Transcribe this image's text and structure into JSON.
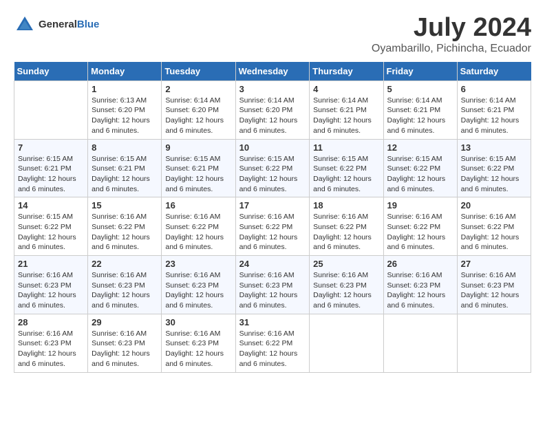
{
  "header": {
    "logo_general": "General",
    "logo_blue": "Blue",
    "month_title": "July 2024",
    "location": "Oyambarillo, Pichincha, Ecuador"
  },
  "days_of_week": [
    "Sunday",
    "Monday",
    "Tuesday",
    "Wednesday",
    "Thursday",
    "Friday",
    "Saturday"
  ],
  "weeks": [
    [
      {
        "day": "",
        "info": ""
      },
      {
        "day": "1",
        "info": "Sunrise: 6:13 AM\nSunset: 6:20 PM\nDaylight: 12 hours\nand 6 minutes."
      },
      {
        "day": "2",
        "info": "Sunrise: 6:14 AM\nSunset: 6:20 PM\nDaylight: 12 hours\nand 6 minutes."
      },
      {
        "day": "3",
        "info": "Sunrise: 6:14 AM\nSunset: 6:20 PM\nDaylight: 12 hours\nand 6 minutes."
      },
      {
        "day": "4",
        "info": "Sunrise: 6:14 AM\nSunset: 6:21 PM\nDaylight: 12 hours\nand 6 minutes."
      },
      {
        "day": "5",
        "info": "Sunrise: 6:14 AM\nSunset: 6:21 PM\nDaylight: 12 hours\nand 6 minutes."
      },
      {
        "day": "6",
        "info": "Sunrise: 6:14 AM\nSunset: 6:21 PM\nDaylight: 12 hours\nand 6 minutes."
      }
    ],
    [
      {
        "day": "7",
        "info": "Sunrise: 6:15 AM\nSunset: 6:21 PM\nDaylight: 12 hours\nand 6 minutes."
      },
      {
        "day": "8",
        "info": "Sunrise: 6:15 AM\nSunset: 6:21 PM\nDaylight: 12 hours\nand 6 minutes."
      },
      {
        "day": "9",
        "info": "Sunrise: 6:15 AM\nSunset: 6:21 PM\nDaylight: 12 hours\nand 6 minutes."
      },
      {
        "day": "10",
        "info": "Sunrise: 6:15 AM\nSunset: 6:22 PM\nDaylight: 12 hours\nand 6 minutes."
      },
      {
        "day": "11",
        "info": "Sunrise: 6:15 AM\nSunset: 6:22 PM\nDaylight: 12 hours\nand 6 minutes."
      },
      {
        "day": "12",
        "info": "Sunrise: 6:15 AM\nSunset: 6:22 PM\nDaylight: 12 hours\nand 6 minutes."
      },
      {
        "day": "13",
        "info": "Sunrise: 6:15 AM\nSunset: 6:22 PM\nDaylight: 12 hours\nand 6 minutes."
      }
    ],
    [
      {
        "day": "14",
        "info": "Sunrise: 6:15 AM\nSunset: 6:22 PM\nDaylight: 12 hours\nand 6 minutes."
      },
      {
        "day": "15",
        "info": "Sunrise: 6:16 AM\nSunset: 6:22 PM\nDaylight: 12 hours\nand 6 minutes."
      },
      {
        "day": "16",
        "info": "Sunrise: 6:16 AM\nSunset: 6:22 PM\nDaylight: 12 hours\nand 6 minutes."
      },
      {
        "day": "17",
        "info": "Sunrise: 6:16 AM\nSunset: 6:22 PM\nDaylight: 12 hours\nand 6 minutes."
      },
      {
        "day": "18",
        "info": "Sunrise: 6:16 AM\nSunset: 6:22 PM\nDaylight: 12 hours\nand 6 minutes."
      },
      {
        "day": "19",
        "info": "Sunrise: 6:16 AM\nSunset: 6:22 PM\nDaylight: 12 hours\nand 6 minutes."
      },
      {
        "day": "20",
        "info": "Sunrise: 6:16 AM\nSunset: 6:22 PM\nDaylight: 12 hours\nand 6 minutes."
      }
    ],
    [
      {
        "day": "21",
        "info": "Sunrise: 6:16 AM\nSunset: 6:23 PM\nDaylight: 12 hours\nand 6 minutes."
      },
      {
        "day": "22",
        "info": "Sunrise: 6:16 AM\nSunset: 6:23 PM\nDaylight: 12 hours\nand 6 minutes."
      },
      {
        "day": "23",
        "info": "Sunrise: 6:16 AM\nSunset: 6:23 PM\nDaylight: 12 hours\nand 6 minutes."
      },
      {
        "day": "24",
        "info": "Sunrise: 6:16 AM\nSunset: 6:23 PM\nDaylight: 12 hours\nand 6 minutes."
      },
      {
        "day": "25",
        "info": "Sunrise: 6:16 AM\nSunset: 6:23 PM\nDaylight: 12 hours\nand 6 minutes."
      },
      {
        "day": "26",
        "info": "Sunrise: 6:16 AM\nSunset: 6:23 PM\nDaylight: 12 hours\nand 6 minutes."
      },
      {
        "day": "27",
        "info": "Sunrise: 6:16 AM\nSunset: 6:23 PM\nDaylight: 12 hours\nand 6 minutes."
      }
    ],
    [
      {
        "day": "28",
        "info": "Sunrise: 6:16 AM\nSunset: 6:23 PM\nDaylight: 12 hours\nand 6 minutes."
      },
      {
        "day": "29",
        "info": "Sunrise: 6:16 AM\nSunset: 6:23 PM\nDaylight: 12 hours\nand 6 minutes."
      },
      {
        "day": "30",
        "info": "Sunrise: 6:16 AM\nSunset: 6:23 PM\nDaylight: 12 hours\nand 6 minutes."
      },
      {
        "day": "31",
        "info": "Sunrise: 6:16 AM\nSunset: 6:22 PM\nDaylight: 12 hours\nand 6 minutes."
      },
      {
        "day": "",
        "info": ""
      },
      {
        "day": "",
        "info": ""
      },
      {
        "day": "",
        "info": ""
      }
    ]
  ]
}
